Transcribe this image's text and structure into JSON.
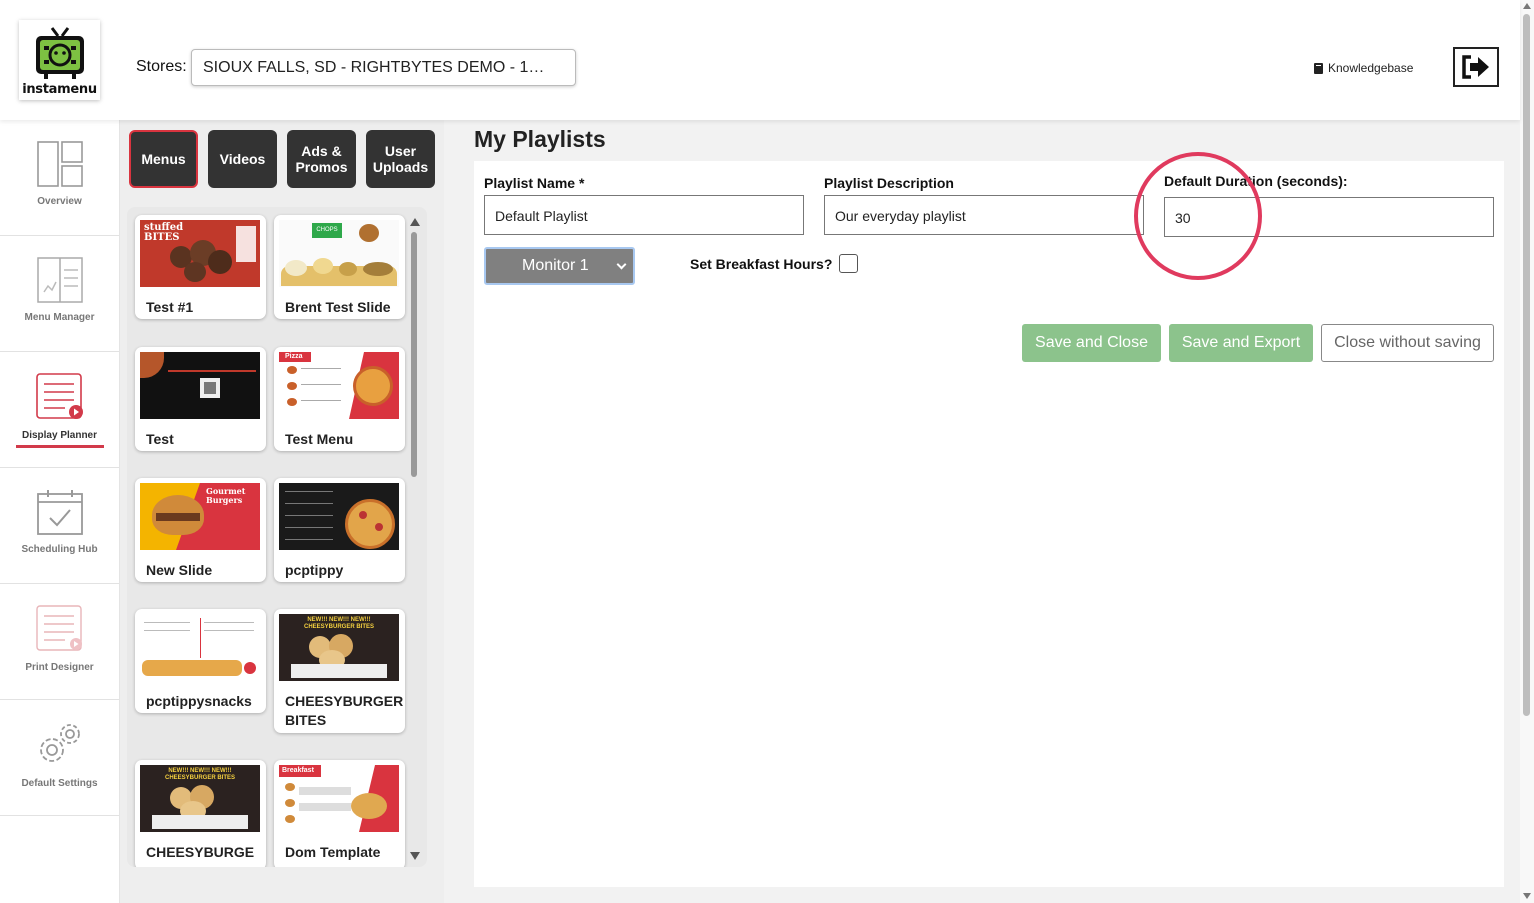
{
  "header": {
    "logo_text": "instamenu",
    "stores_label": "Stores:",
    "stores_value": "SIOUX FALLS, SD - RIGHTBYTES DEMO - 1…",
    "knowledgebase_label": "Knowledgebase",
    "logout_icon": "logout-icon"
  },
  "nav": {
    "items": [
      {
        "label": "Overview",
        "icon": "overview-icon"
      },
      {
        "label": "Menu Manager",
        "icon": "menu-manager-icon"
      },
      {
        "label": "Display Planner",
        "icon": "display-planner-icon",
        "active": true
      },
      {
        "label": "Scheduling Hub",
        "icon": "calendar-check-icon"
      },
      {
        "label": "Print Designer",
        "icon": "print-designer-icon"
      },
      {
        "label": "Default Settings",
        "icon": "gears-icon"
      }
    ]
  },
  "media": {
    "tabs": [
      {
        "label": "Menus",
        "active": true
      },
      {
        "label": "Videos"
      },
      {
        "label": "Ads & Promos"
      },
      {
        "label": "User Uploads"
      }
    ],
    "tiles": [
      {
        "label": "Test #1",
        "thumb_text": "stuffed BITES"
      },
      {
        "label": "Brent Test Slide",
        "thumb_text": "CHOPS"
      },
      {
        "label": "Test"
      },
      {
        "label": "Test Menu",
        "thumb_text": "Pizza"
      },
      {
        "label": "New Slide",
        "thumb_text": "Gourmet Burgers"
      },
      {
        "label": "pcptippy"
      },
      {
        "label": "pcptippysnacks"
      },
      {
        "label": "CHEESYBURGER BITES",
        "thumb_text": "NEW!!! NEW!!! NEW!!! CHEESYBURGER BITES"
      },
      {
        "label": "CHEESYBURGE",
        "thumb_text": "NEW!!! NEW!!! NEW!!! CHEESYBURGER BITES"
      },
      {
        "label": "Dom Template",
        "thumb_text": "Breakfast"
      }
    ]
  },
  "main": {
    "title": "My Playlists",
    "playlist_name_label": "Playlist Name *",
    "playlist_name_value": "Default Playlist",
    "playlist_desc_label": "Playlist Description",
    "playlist_desc_value": "Our everyday playlist",
    "duration_label": "Default Duration (seconds):",
    "duration_value": "30",
    "monitor_value": "Monitor 1",
    "breakfast_label": "Set Breakfast Hours?",
    "buttons": {
      "save_close": "Save and Close",
      "save_export": "Save and Export",
      "close_no_save": "Close without saving"
    }
  },
  "colors": {
    "accent_red": "#d23a4a",
    "button_green": "#8cc38c",
    "tab_dark": "#333333",
    "highlight": "#e03a5e"
  }
}
